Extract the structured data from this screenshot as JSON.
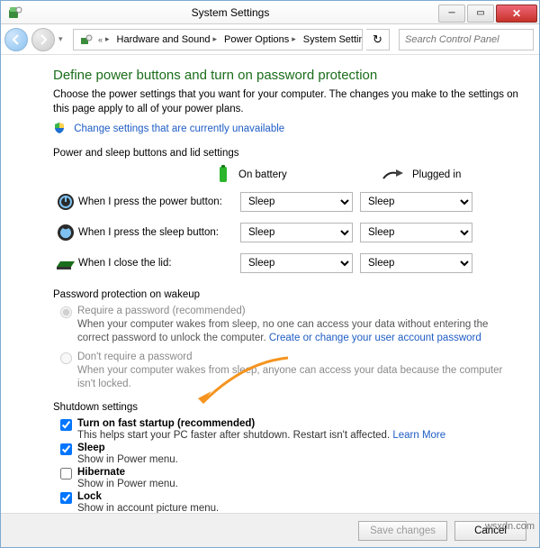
{
  "window": {
    "title": "System Settings"
  },
  "nav": {
    "crumbs": [
      "Hardware and Sound",
      "Power Options",
      "System Settings"
    ],
    "search_placeholder": "Search Control Panel"
  },
  "page": {
    "heading": "Define power buttons and turn on password protection",
    "intro": "Choose the power settings that you want for your computer. The changes you make to the settings on this page apply to all of your power plans.",
    "change_link": "Change settings that are currently unavailable"
  },
  "buttons_section": {
    "label": "Power and sleep buttons and lid settings",
    "col_battery": "On battery",
    "col_plugged": "Plugged in",
    "rows": [
      {
        "label": "When I press the power button:",
        "battery": "Sleep",
        "plugged": "Sleep"
      },
      {
        "label": "When I press the sleep button:",
        "battery": "Sleep",
        "plugged": "Sleep"
      },
      {
        "label": "When I close the lid:",
        "battery": "Sleep",
        "plugged": "Sleep"
      }
    ]
  },
  "password_section": {
    "label": "Password protection on wakeup",
    "opt1_title": "Require a password (recommended)",
    "opt1_desc_a": "When your computer wakes from sleep, no one can access your data without entering the correct password to unlock the computer. ",
    "opt1_link": "Create or change your user account password",
    "opt2_title": "Don't require a password",
    "opt2_desc": "When your computer wakes from sleep, anyone can access your data because the computer isn't locked."
  },
  "shutdown_section": {
    "label": "Shutdown settings",
    "items": [
      {
        "title": "Turn on fast startup (recommended)",
        "desc_a": "This helps start your PC faster after shutdown. Restart isn't affected. ",
        "link": "Learn More",
        "checked": true
      },
      {
        "title": "Sleep",
        "desc": "Show in Power menu.",
        "checked": true
      },
      {
        "title": "Hibernate",
        "desc": "Show in Power menu.",
        "checked": false
      },
      {
        "title": "Lock",
        "desc": "Show in account picture menu.",
        "checked": true
      }
    ]
  },
  "footer": {
    "save": "Save changes",
    "cancel": "Cancel"
  },
  "watermark": "wsxdn.com"
}
